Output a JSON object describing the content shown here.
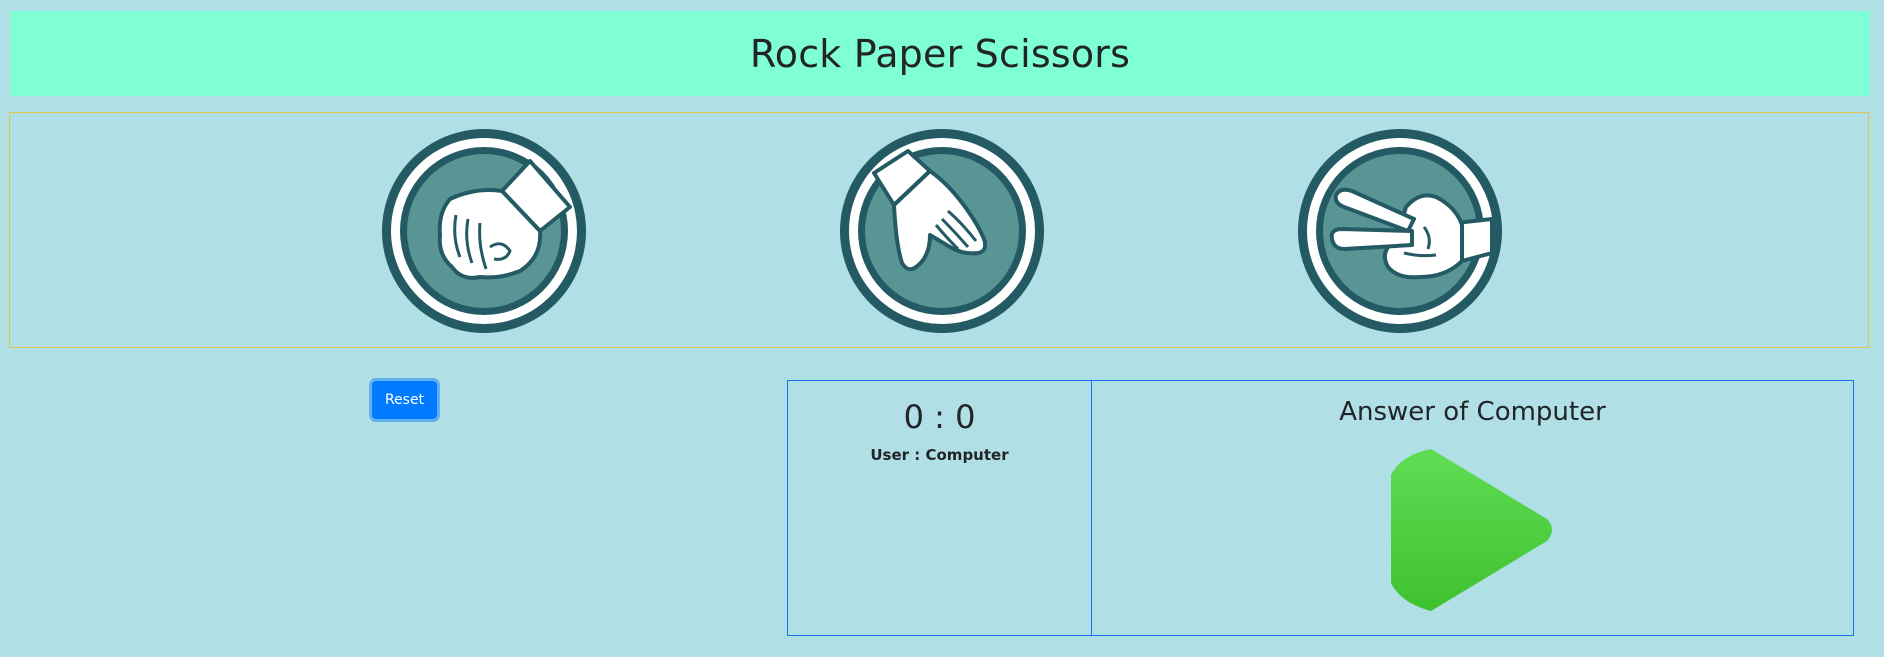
{
  "header": {
    "title": "Rock Paper Scissors"
  },
  "choices": [
    {
      "name": "rock",
      "icon": "rock-fist-icon"
    },
    {
      "name": "paper",
      "icon": "paper-hand-icon"
    },
    {
      "name": "scissors",
      "icon": "scissors-hand-icon"
    }
  ],
  "controls": {
    "reset_label": "Reset"
  },
  "score": {
    "value": "0 : 0",
    "caption": "User : Computer"
  },
  "answer": {
    "title": "Answer of Computer",
    "icon": "play-icon"
  },
  "colors": {
    "page_bg": "#b0dfe5",
    "header_bg": "#7fffd4",
    "icon_dark": "#245a63",
    "icon_mid": "#5a9595",
    "button": "#007bff",
    "play_green": "#47cf3a"
  }
}
